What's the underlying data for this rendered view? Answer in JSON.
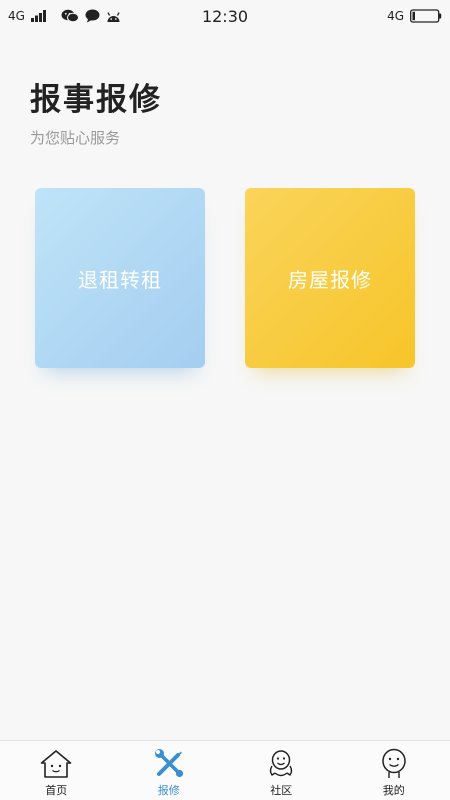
{
  "status_bar": {
    "network_left": "4G",
    "time": "12:30",
    "network_right": "4G"
  },
  "header": {
    "title": "报事报修",
    "subtitle": "为您贴心服务"
  },
  "cards": {
    "rent_transfer": {
      "label": "退租转租"
    },
    "house_repair": {
      "label": "房屋报修"
    }
  },
  "colors": {
    "background": "#f7f7f7",
    "rent_card_start": "#bfe4f8",
    "rent_card_end": "#a4cdf0",
    "repair_card_start": "#fad45a",
    "repair_card_end": "#f7c52a",
    "active_tab": "#3a8fd0"
  },
  "tab_bar": {
    "active": "repair",
    "tabs": [
      {
        "id": "home",
        "label": "首页",
        "icon": "house-face-icon"
      },
      {
        "id": "repair",
        "label": "报修",
        "icon": "wrench-screwdriver-icon"
      },
      {
        "id": "community",
        "label": "社区",
        "icon": "smiley-hands-icon"
      },
      {
        "id": "mine",
        "label": "我的",
        "icon": "smiley-face-icon"
      }
    ]
  }
}
